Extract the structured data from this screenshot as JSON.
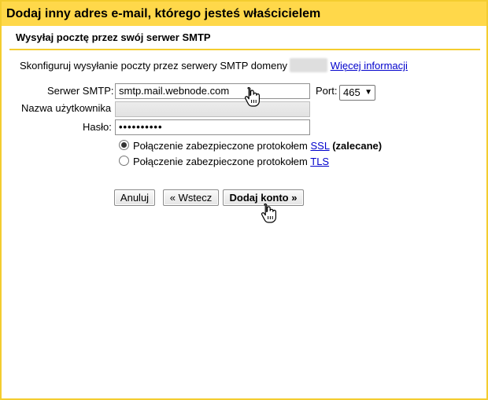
{
  "window": {
    "title": "Dodaj inny adres e-mail, którego jesteś właścicielem",
    "section_title": "Wysyłaj pocztę przez swój serwer SMTP"
  },
  "description": {
    "text": "Skonfiguruj wysyłanie poczty przez serwery SMTP domeny",
    "link": "Więcej informacji"
  },
  "form": {
    "smtp_label": "Serwer SMTP:",
    "smtp_value": "smtp.mail.webnode.com",
    "port_label": "Port:",
    "port_value": "465",
    "username_label": "Nazwa użytkownika",
    "username_value": "",
    "password_label": "Hasło:",
    "password_value": "••••••••••"
  },
  "security": {
    "ssl_text": "Połączenie zabezpieczone protokołem",
    "ssl_link": "SSL",
    "ssl_note": "(zalecane)",
    "ssl_selected": true,
    "tls_text": "Połączenie zabezpieczone protokołem",
    "tls_link": "TLS",
    "tls_selected": false
  },
  "buttons": {
    "cancel": "Anuluj",
    "back": "« Wstecz",
    "add_account": "Dodaj konto »"
  },
  "colors": {
    "title_bar": "#ffd84a",
    "border": "#f4cd2f",
    "link": "#0000cc"
  }
}
